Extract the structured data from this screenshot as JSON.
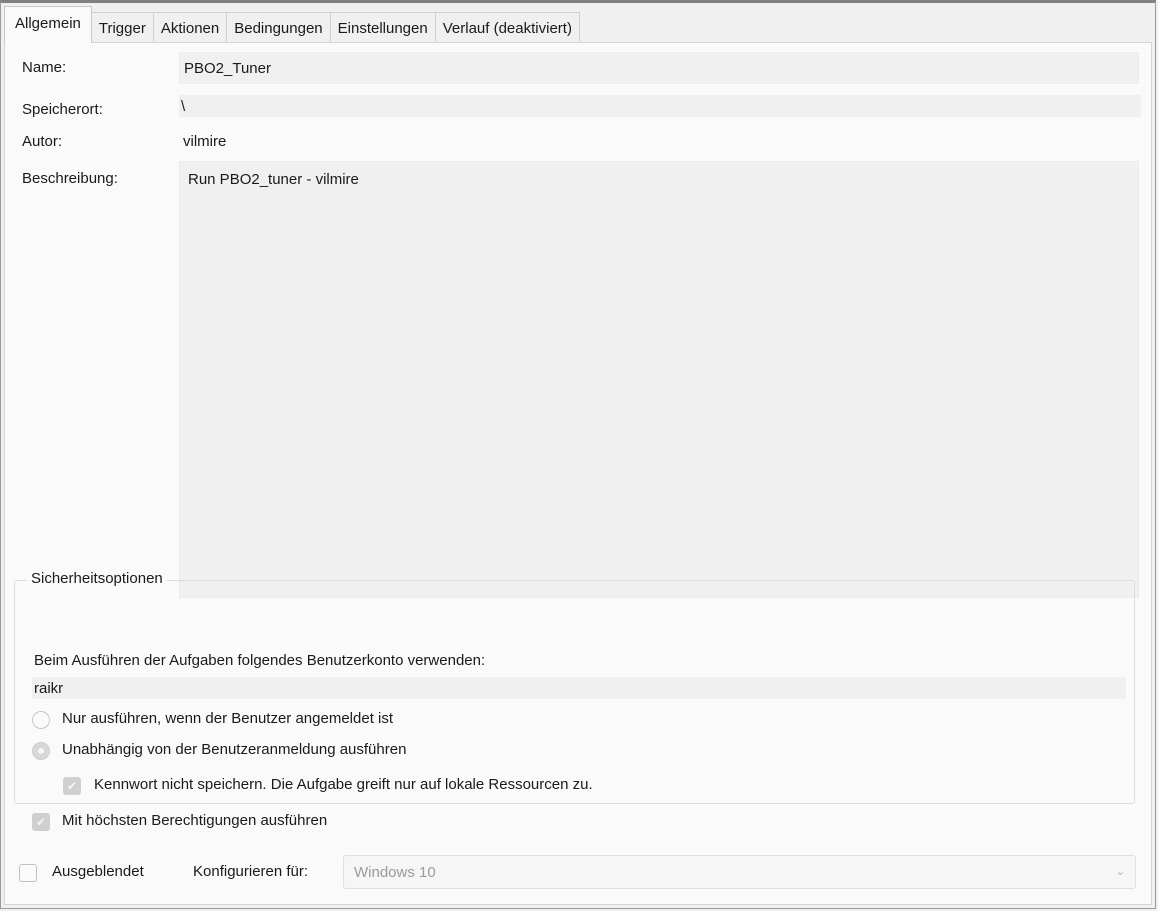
{
  "tabs": [
    {
      "label": "Allgemein",
      "active": true
    },
    {
      "label": "Trigger",
      "active": false
    },
    {
      "label": "Aktionen",
      "active": false
    },
    {
      "label": "Bedingungen",
      "active": false
    },
    {
      "label": "Einstellungen",
      "active": false
    },
    {
      "label": "Verlauf (deaktiviert)",
      "active": false
    }
  ],
  "general": {
    "name_label": "Name:",
    "name_value": "PBO2_Tuner",
    "location_label": "Speicherort:",
    "location_value": "\\",
    "author_label": "Autor:",
    "author_value": "vilmire",
    "description_label": "Beschreibung:",
    "description_value": "Run PBO2_tuner - vilmire"
  },
  "security": {
    "title": "Sicherheitsoptionen",
    "account_prompt": "Beim Ausführen der Aufgaben folgendes Benutzerkonto verwenden:",
    "account_value": "raikr",
    "radio_logged_on": "Nur ausführen, wenn der Benutzer angemeldet ist",
    "radio_independent": "Unabhängig von der Benutzeranmeldung ausführen",
    "check_no_password": "Kennwort nicht speichern. Die Aufgabe greift nur auf lokale Ressourcen zu.",
    "check_highest": "Mit höchsten Berechtigungen ausführen"
  },
  "footer": {
    "hidden_label": "Ausgeblendet",
    "configure_label": "Konfigurieren für:",
    "configure_value": "Windows 10"
  },
  "icons": {
    "combo_arrow": "chevron-down-icon",
    "check_mark": "checkmark-icon"
  }
}
